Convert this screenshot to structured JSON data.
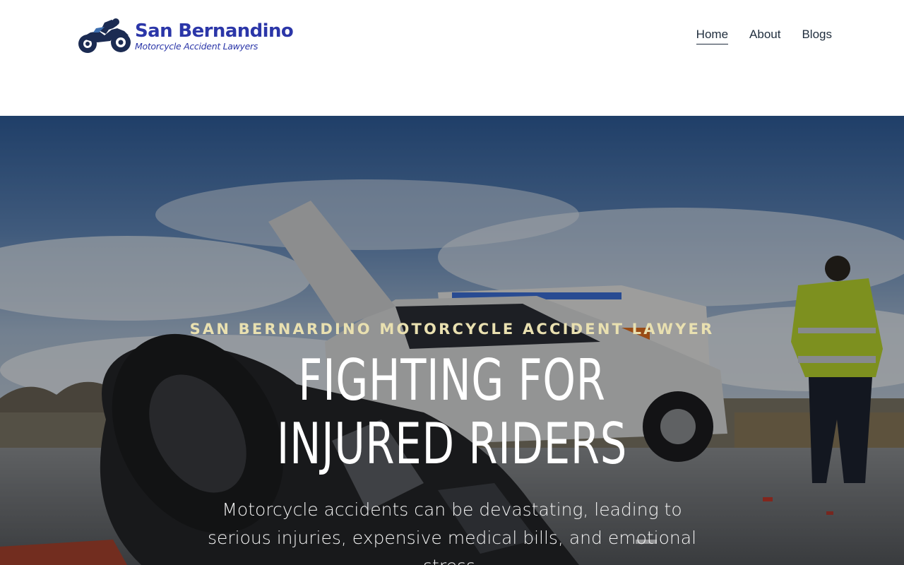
{
  "brand": {
    "name": "San Bernandino",
    "tagline": "Motorcycle Accident Lawyers",
    "accent_color": "#2b36a8",
    "icon": "motorcycle-icon"
  },
  "nav": {
    "items": [
      {
        "label": "Home",
        "active": true
      },
      {
        "label": "About",
        "active": false
      },
      {
        "label": "Blogs",
        "active": false
      }
    ]
  },
  "hero": {
    "kicker": "SAN BERNARDINO MOTORCYCLE ACCIDENT LAWYER",
    "title": "FIGHTING FOR INJURED RIDERS",
    "text": "Motorcycle accidents can be devastating, leading to serious injuries, expensive medical bills, and emotional stress.",
    "kicker_color": "#e9e0b0"
  }
}
